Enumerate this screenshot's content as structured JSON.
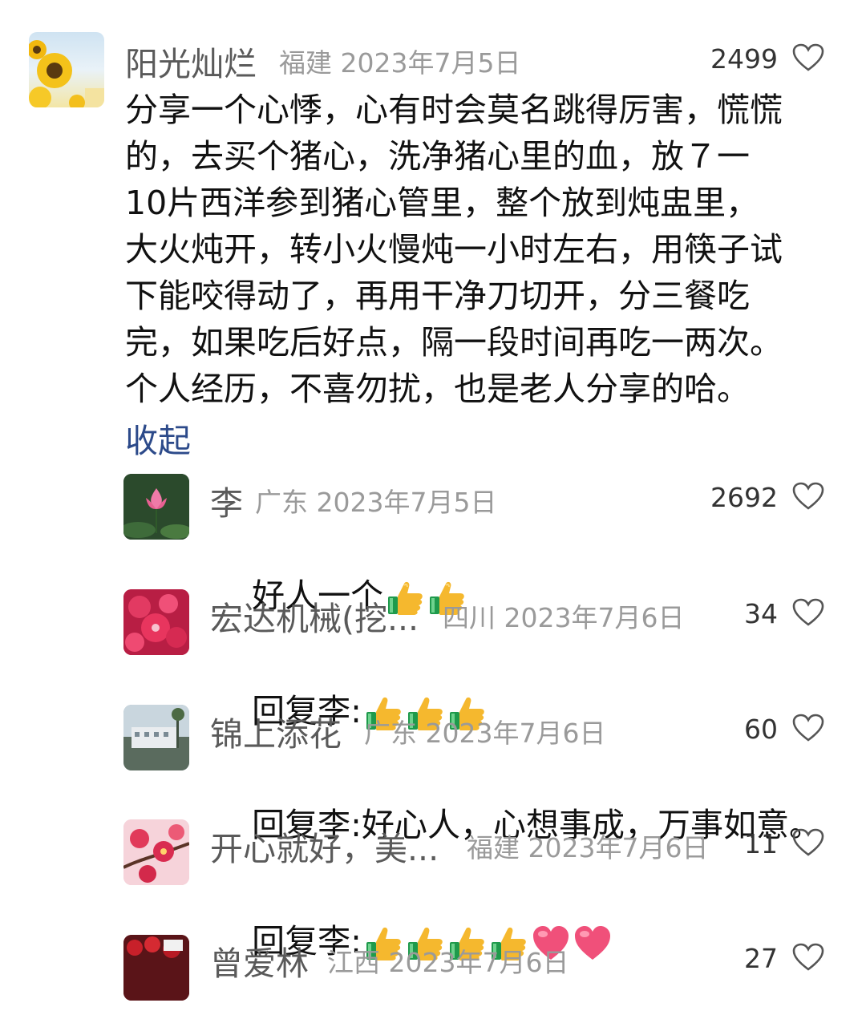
{
  "comments": [
    {
      "author": "阳光灿烂",
      "region": "福建",
      "date": "2023年7月5日",
      "likes": "2499",
      "avatar": "sunflower-avatar",
      "text_lines": [
        "分享一个心悸，心有时会莫名跳得厉害，慌慌",
        "的，去买个猪心，洗净猪心里的血，放７一",
        "10片西洋参到猪心管里，整个放到炖盅里，",
        "大火炖开，转小火慢炖一小时左右，用筷子试",
        "下能咬得动了，再用干净刀切开，分三餐吃",
        "完，如果吃后好点，隔一段时间再吃一两次。",
        "个人经历，不喜勿扰，也是老人分享的哈。"
      ],
      "collapse_label": "收起"
    }
  ],
  "replies": [
    {
      "author": "李",
      "region": "广东",
      "date": "2023年7月5日",
      "likes": "2692",
      "avatar": "pink-lotus-avatar",
      "text": "好人一个",
      "emojis": [
        "thumbs-up",
        "thumbs-up"
      ]
    },
    {
      "author": "宏达机械(挖...",
      "region": "四川",
      "date": "2023年7月6日",
      "likes": "34",
      "avatar": "red-flower-avatar",
      "text": "回复李:",
      "emojis": [
        "thumbs-up",
        "thumbs-up",
        "thumbs-up"
      ]
    },
    {
      "author": "锦上添花",
      "region": "广东",
      "date": "2023年7月6日",
      "likes": "60",
      "avatar": "building-avatar",
      "text": "回复李:好心人，心想事成，万事如意。",
      "emojis": []
    },
    {
      "author": "开心就好，美...",
      "region": "福建",
      "date": "2023年7月6日",
      "likes": "11",
      "avatar": "plum-blossom-avatar",
      "text": "回复李:",
      "emojis": [
        "thumbs-up",
        "thumbs-up",
        "thumbs-up",
        "thumbs-up",
        "heart",
        "heart"
      ]
    },
    {
      "author": "曾爱林",
      "region": "江西",
      "date": "2023年7月6日",
      "likes": "27",
      "avatar": "roses-avatar",
      "text": "",
      "emojis": []
    }
  ],
  "colors": {
    "author": "#5a5a5a",
    "meta": "#9a9a9a",
    "text": "#111111",
    "link": "#2c4a8a",
    "heart_outline": "#555555",
    "heart_emoji": "#f0507a",
    "thumb": "#f5b82e"
  }
}
